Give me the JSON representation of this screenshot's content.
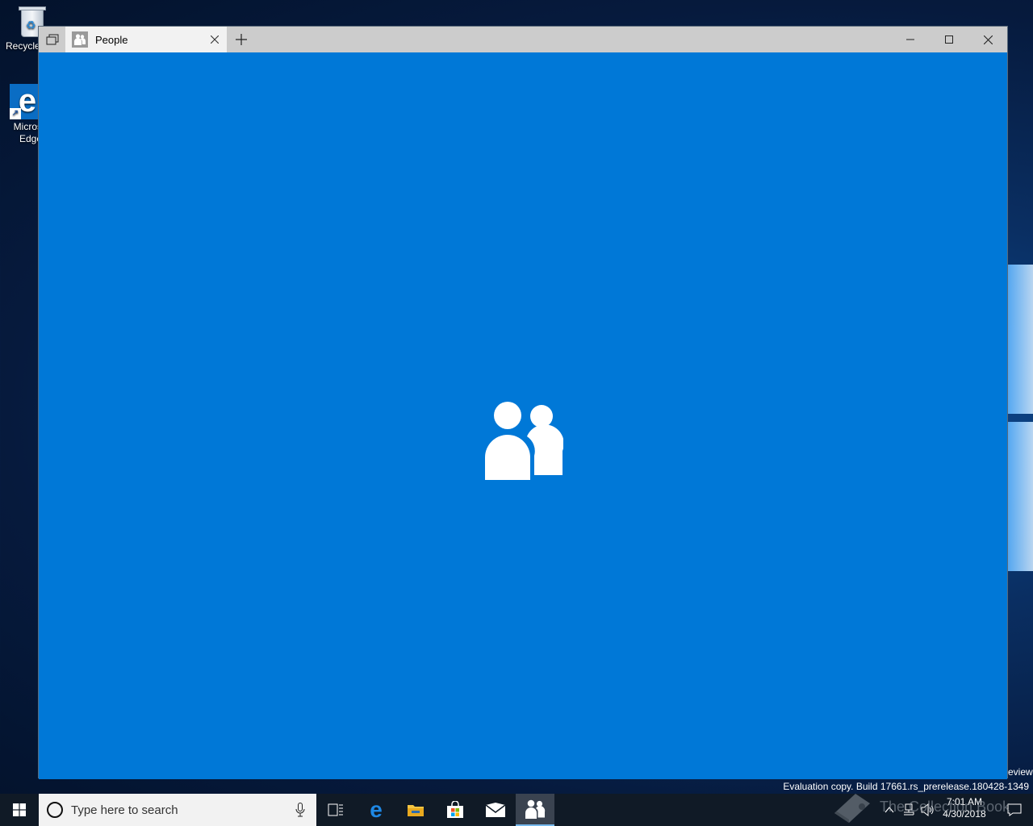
{
  "desktop": {
    "icons": [
      {
        "label": "Recycle"
      },
      {
        "label": "Micros\nEdge"
      }
    ]
  },
  "window": {
    "tab_title": "People",
    "colors": {
      "accent": "#0078d7",
      "titlebar": "#cccccc"
    },
    "icons": {
      "set_aside": "set-aside-tabs-icon",
      "tab": "people-icon",
      "tab_close": "close-icon",
      "new_tab": "plus-icon",
      "minimize": "minimize-icon",
      "maximize": "maximize-icon",
      "close": "close-icon",
      "splash": "people-icon"
    }
  },
  "overlay": {
    "preview_fragment": "eview",
    "evaluation": "Evaluation copy. Build 17661.rs_prerelease.180428-1349",
    "watermark": "The Collection Book"
  },
  "taskbar": {
    "search_placeholder": "Type here to search",
    "apps": [
      "task-view",
      "edge",
      "file-explorer",
      "store",
      "mail",
      "people"
    ],
    "active_app": "people",
    "clock": {
      "time": "7:01 AM",
      "date": "4/30/2018"
    }
  }
}
